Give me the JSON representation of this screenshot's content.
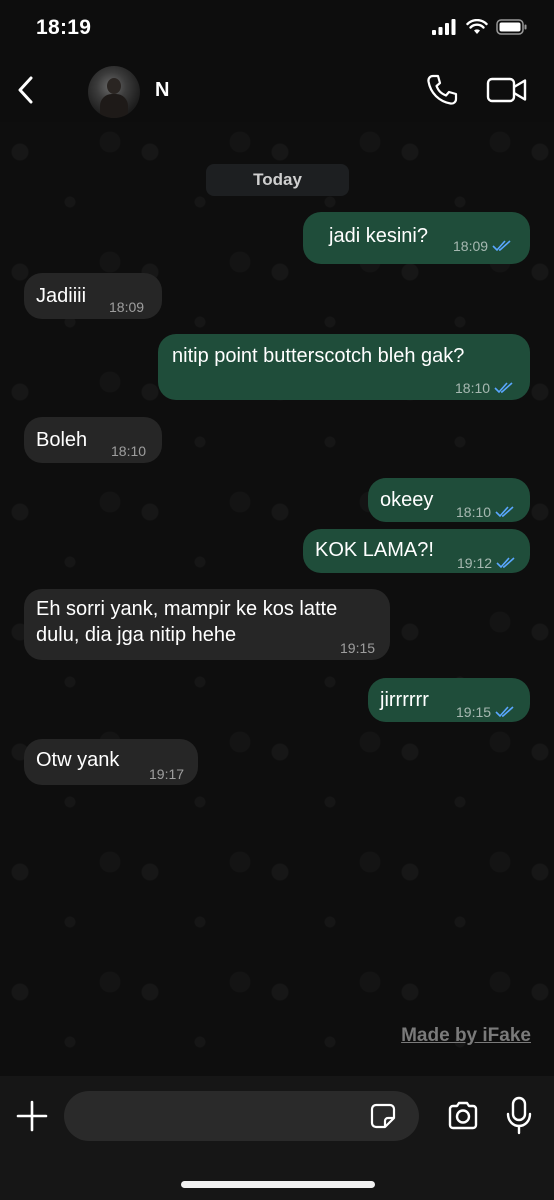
{
  "status_bar": {
    "time": "18:19"
  },
  "header": {
    "contact_name": "N"
  },
  "chat": {
    "date_label": "Today",
    "messages": [
      {
        "direction": "out",
        "text": "jadi kesini?",
        "time": "18:09",
        "read": true
      },
      {
        "direction": "in",
        "text": "Jadiiii",
        "time": "18:09"
      },
      {
        "direction": "out",
        "text": "nitip point butterscotch bleh gak?",
        "time": "18:10",
        "read": true
      },
      {
        "direction": "in",
        "text": "Boleh",
        "time": "18:10"
      },
      {
        "direction": "out",
        "text": "okeey",
        "time": "18:10",
        "read": true
      },
      {
        "direction": "out",
        "text": "KOK LAMA?!",
        "time": "19:12",
        "read": true
      },
      {
        "direction": "in",
        "text_line1": "Eh sorri yank, mampir ke kos latte",
        "text_line2": "dulu, dia jga nitip hehe",
        "time": "19:15"
      },
      {
        "direction": "out",
        "text": "jirrrrrr",
        "time": "19:15",
        "read": true
      },
      {
        "direction": "in",
        "text": "Otw yank",
        "time": "19:17"
      }
    ],
    "watermark": "Made by iFake"
  },
  "input": {
    "value": "",
    "placeholder": ""
  },
  "icons": {
    "back": "chevron-left-icon",
    "call": "phone-icon",
    "video": "video-camera-icon",
    "plus": "plus-icon",
    "sticker": "sticker-icon",
    "camera": "camera-icon",
    "mic": "microphone-icon",
    "read_receipt": "double-check-icon"
  },
  "colors": {
    "outgoing_bubble": "#1f4d3a",
    "incoming_bubble": "#262626",
    "read_tick": "#5aa7ff",
    "background": "#0e0e0e"
  }
}
